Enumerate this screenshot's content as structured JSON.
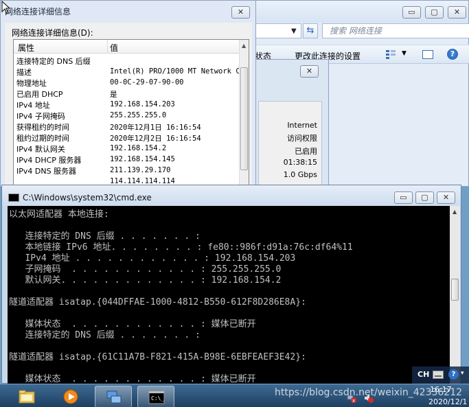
{
  "explorer": {
    "search_placeholder": "搜索 网络连接",
    "cmd_items": [
      "状态",
      "更改此连接的设置"
    ],
    "buttons": {
      "minimize": "▭",
      "maximize": "▢",
      "close": "✕"
    }
  },
  "status_dialog": {
    "values": [
      "Internet",
      "访问权限",
      "已启用",
      "01:38:15",
      "1.0 Gbps"
    ],
    "close": "✕"
  },
  "details": {
    "title": "网络连接详细信息",
    "caption": "网络连接详细信息(D):",
    "close": "✕",
    "columns": [
      "属性",
      "值"
    ],
    "rows": [
      {
        "key": "连接特定的 DNS 后缀",
        "value": ""
      },
      {
        "key": "描述",
        "value": "Intel(R) PRO/1000 MT Network C"
      },
      {
        "key": "物理地址",
        "value": "00-0C-29-07-90-00"
      },
      {
        "key": "已启用 DHCP",
        "value": "是"
      },
      {
        "key": "IPv4 地址",
        "value": "192.168.154.203"
      },
      {
        "key": "IPv4 子网掩码",
        "value": "255.255.255.0"
      },
      {
        "key": "获得租约的时间",
        "value": "2020年12月1日 16:16:54"
      },
      {
        "key": "租约过期的时间",
        "value": "2020年12月2日 16:16:54"
      },
      {
        "key": "IPv4 默认网关",
        "value": "192.168.154.2"
      },
      {
        "key": "IPv4 DHCP 服务器",
        "value": "192.168.154.145"
      },
      {
        "key": "IPv4 DNS 服务器",
        "value": "211.139.29.170"
      },
      {
        "key": "",
        "value": "114.114.114.114"
      }
    ]
  },
  "cmd": {
    "title": "C:\\Windows\\system32\\cmd.exe",
    "buttons": {
      "minimize": "▭",
      "maximize": "▢",
      "close": "✕"
    },
    "lines": [
      "以太网适配器 本地连接:",
      "",
      "   连接特定的 DNS 后缀 . . . . . . . :",
      "   本地链接 IPv6 地址. . . . . . . . : fe80::986f:d91a:76c:df64%11",
      "   IPv4 地址 . . . . . . . . . . . . : 192.168.154.203",
      "   子网掩码  . . . . . . . . . . . . : 255.255.255.0",
      "   默认网关. . . . . . . . . . . . . : 192.168.154.2",
      "",
      "隧道适配器 isatap.{044DFFAE-1000-4812-B550-612F8D286E8A}:",
      "",
      "   媒体状态  . . . . . . . . . . . . : 媒体已断开",
      "   连接特定的 DNS 后缀 . . . . . . . :",
      "",
      "隧道适配器 isatap.{61C11A7B-F821-415A-B98E-6EBFEAEF3E42}:",
      "",
      "   媒体状态  . . . . . . . . . . . . : 媒体已断开"
    ]
  },
  "taskbar": {
    "tray_lang": "CH",
    "clock_time": "16:17",
    "clock_date": "2020/12/1",
    "watermark": "https://blog.csdn.net/weixin_42336212"
  }
}
